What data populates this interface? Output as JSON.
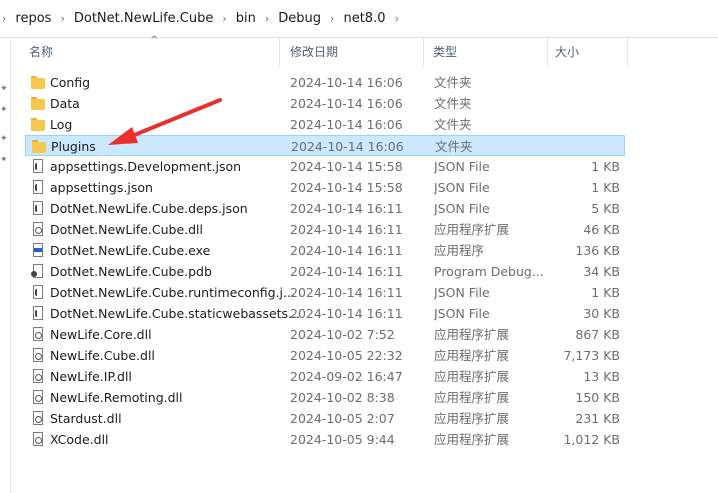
{
  "breadcrumb": [
    "repos",
    "DotNet.NewLife.Cube",
    "bin",
    "Debug",
    "net8.0"
  ],
  "columns": {
    "name": "名称",
    "date": "修改日期",
    "type": "类型",
    "size": "大小"
  },
  "rows": [
    {
      "name": "Config",
      "date": "2024-10-14 16:06",
      "type": "文件夹",
      "size": "",
      "icon": "folder-icon"
    },
    {
      "name": "Data",
      "date": "2024-10-14 16:06",
      "type": "文件夹",
      "size": "",
      "icon": "folder-icon"
    },
    {
      "name": "Log",
      "date": "2024-10-14 16:06",
      "type": "文件夹",
      "size": "",
      "icon": "folder-icon"
    },
    {
      "name": "Plugins",
      "date": "2024-10-14 16:06",
      "type": "文件夹",
      "size": "",
      "icon": "folder-icon",
      "selected": true
    },
    {
      "name": "appsettings.Development.json",
      "date": "2024-10-14 15:58",
      "type": "JSON File",
      "size": "1 KB",
      "icon": "json-file-icon"
    },
    {
      "name": "appsettings.json",
      "date": "2024-10-14 15:58",
      "type": "JSON File",
      "size": "1 KB",
      "icon": "json-file-icon"
    },
    {
      "name": "DotNet.NewLife.Cube.deps.json",
      "date": "2024-10-14 16:11",
      "type": "JSON File",
      "size": "5 KB",
      "icon": "json-file-icon"
    },
    {
      "name": "DotNet.NewLife.Cube.dll",
      "date": "2024-10-14 16:11",
      "type": "应用程序扩展",
      "size": "46 KB",
      "icon": "dll-file-icon"
    },
    {
      "name": "DotNet.NewLife.Cube.exe",
      "date": "2024-10-14 16:11",
      "type": "应用程序",
      "size": "136 KB",
      "icon": "exe-file-icon"
    },
    {
      "name": "DotNet.NewLife.Cube.pdb",
      "date": "2024-10-14 16:11",
      "type": "Program Debug...",
      "size": "34 KB",
      "icon": "pdb-file-icon"
    },
    {
      "name": "DotNet.NewLife.Cube.runtimeconfig.j...",
      "date": "2024-10-14 16:11",
      "type": "JSON File",
      "size": "1 KB",
      "icon": "json-file-icon"
    },
    {
      "name": "DotNet.NewLife.Cube.staticwebassets...",
      "date": "2024-10-14 16:11",
      "type": "JSON File",
      "size": "30 KB",
      "icon": "json-file-icon"
    },
    {
      "name": "NewLife.Core.dll",
      "date": "2024-10-02 7:52",
      "type": "应用程序扩展",
      "size": "867 KB",
      "icon": "dll-file-icon"
    },
    {
      "name": "NewLife.Cube.dll",
      "date": "2024-10-05 22:32",
      "type": "应用程序扩展",
      "size": "7,173 KB",
      "icon": "dll-file-icon"
    },
    {
      "name": "NewLife.IP.dll",
      "date": "2024-09-02 16:47",
      "type": "应用程序扩展",
      "size": "13 KB",
      "icon": "dll-file-icon"
    },
    {
      "name": "NewLife.Remoting.dll",
      "date": "2024-10-02 8:38",
      "type": "应用程序扩展",
      "size": "150 KB",
      "icon": "dll-file-icon"
    },
    {
      "name": "Stardust.dll",
      "date": "2024-10-05 2:07",
      "type": "应用程序扩展",
      "size": "231 KB",
      "icon": "dll-file-icon"
    },
    {
      "name": "XCode.dll",
      "date": "2024-10-05 9:44",
      "type": "应用程序扩展",
      "size": "1,012 KB",
      "icon": "dll-file-icon"
    }
  ],
  "colors": {
    "selected_bg": "#cce8ff",
    "selected_border": "#99d1ff",
    "folder": "#f6c94e",
    "annotation_arrow": "#e8312f"
  }
}
